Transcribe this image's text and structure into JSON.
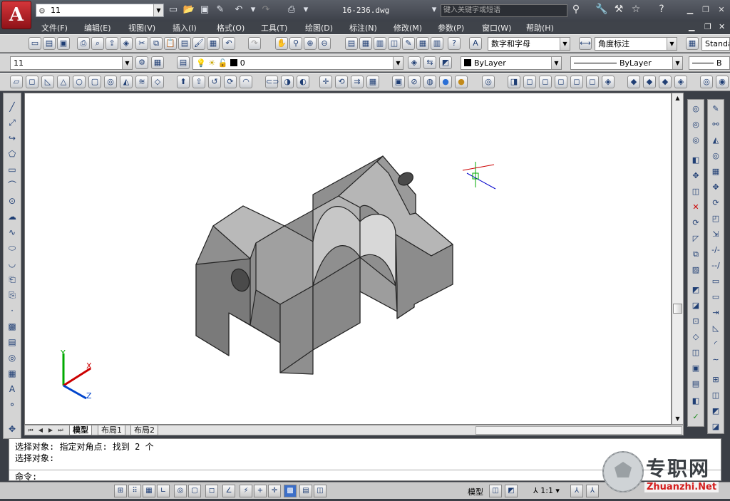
{
  "app": {
    "logo_letter": "A",
    "workspace": "11",
    "doc_title": "16-236.dwg",
    "search_placeholder": "键入关键字或短语"
  },
  "menu": [
    "文件(F)",
    "编辑(E)",
    "视图(V)",
    "插入(I)",
    "格式(O)",
    "工具(T)",
    "绘图(D)",
    "标注(N)",
    "修改(M)",
    "参数(P)",
    "窗口(W)",
    "帮助(H)"
  ],
  "styles": {
    "text_style": "数字和字母",
    "dim_style": "角度标注",
    "table_style": "Standa"
  },
  "layers": {
    "layer_state": "11",
    "current_layer": "0",
    "color": "ByLayer",
    "linetype": "ByLayer",
    "lineweight": "B"
  },
  "ucs": {
    "x": "X",
    "y": "Y",
    "z": "Z"
  },
  "tabs": {
    "model": "模型",
    "layout1": "布局1",
    "layout2": "布局2"
  },
  "command": {
    "line1": "选择对象: 指定对角点: 找到 2 个",
    "line2": "选择对象:",
    "prompt": "命令:"
  },
  "status": {
    "space": "模型",
    "scale": "1:1"
  },
  "watermark": {
    "cn": "专职网",
    "url": "Zhuanzhi.Net"
  },
  "colors": {
    "accent": "#d4363a",
    "solid": "#a9a9a9"
  }
}
